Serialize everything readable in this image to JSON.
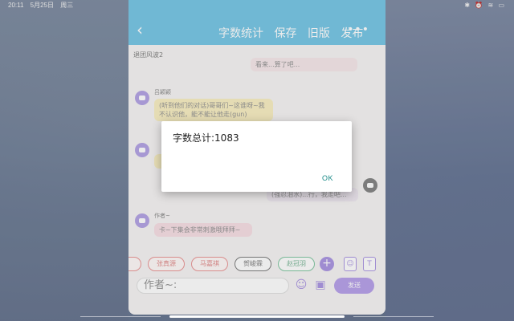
{
  "status_bar": {
    "time": "20:11",
    "date": "5月25日",
    "weekday": "周三",
    "icons": [
      "bluetooth-icon",
      "alarm-icon",
      "wifi-icon",
      "battery-icon"
    ]
  },
  "header": {
    "back_icon": "chevron-left-icon",
    "word_count": "字数统计",
    "save": "保存",
    "old_version": "旧版",
    "publish": "发布",
    "more_icon": "more-dots-icon"
  },
  "chat": {
    "group_name": "退团风波2",
    "messages": [
      {
        "sender": "",
        "text": "看来...算了吧..."
      },
      {
        "sender": "吕颖颖",
        "text": "(听到他们的对话)哥哥们~这谁呀~我不认识他，能不能让他走(gun)"
      },
      {
        "sender": "",
        "text": "(强忍泪水)...行，我走吧..."
      },
      {
        "sender": "作者~",
        "text": "卡~下集会非常刺激哦拜拜~"
      }
    ]
  },
  "toolbar": {
    "characters": [
      "张真源",
      "马嘉祺",
      "贺峻霖",
      "赵冠羽"
    ],
    "add_icon": "plus-icon",
    "person_icon": "person-icon",
    "narration_icon": "text-icon",
    "input_value": "作者~:",
    "emoji_icon": "smile-icon",
    "image_icon": "image-icon",
    "send_label": "发送"
  },
  "dialog": {
    "message": "字数总计:1083",
    "ok_label": "OK"
  },
  "colors": {
    "header": "#2aa7d8",
    "accent": "#8f6be0",
    "dialog_button": "#1a8a87"
  }
}
